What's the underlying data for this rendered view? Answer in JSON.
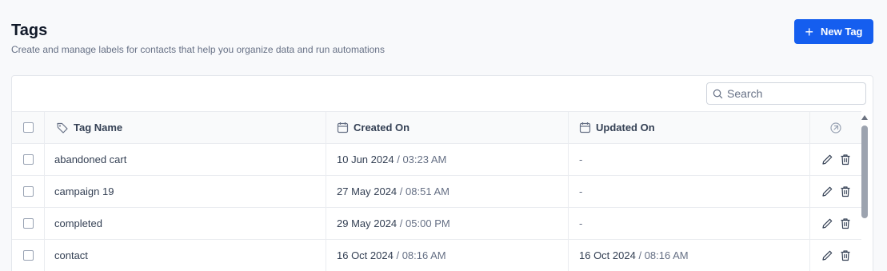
{
  "page": {
    "title": "Tags",
    "subtitle": "Create and manage labels for contacts that help you organize data and run automations",
    "new_button_label": "New Tag"
  },
  "search": {
    "placeholder": "Search"
  },
  "table": {
    "columns": {
      "name": "Tag Name",
      "created": "Created On",
      "updated": "Updated On"
    },
    "rows": [
      {
        "name": "abandoned cart",
        "created_date": "10 Jun 2024",
        "created_time": "03:23 AM",
        "updated": "-"
      },
      {
        "name": "campaign 19",
        "created_date": "27 May 2024",
        "created_time": "08:51 AM",
        "updated": "-"
      },
      {
        "name": "completed",
        "created_date": "29 May 2024",
        "created_time": "05:00 PM",
        "updated": "-"
      },
      {
        "name": "contact",
        "created_date": "16 Oct 2024",
        "created_time": "08:16 AM",
        "updated_date": "16 Oct 2024",
        "updated_time": "08:16 AM"
      }
    ]
  },
  "icons": {
    "tag": "tag-icon",
    "calendar": "calendar-icon",
    "settings": "columns-settings-icon",
    "edit": "pencil-icon",
    "delete": "trash-icon",
    "search": "search-icon",
    "plus": "plus-icon"
  },
  "colors": {
    "primary": "#155eef"
  }
}
